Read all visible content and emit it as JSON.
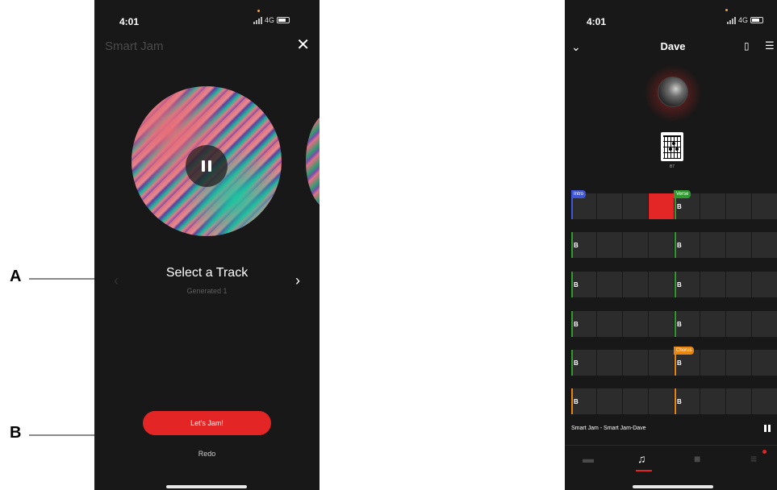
{
  "annotations": {
    "a_label": "A",
    "b_label": "B"
  },
  "left_phone": {
    "status": {
      "time": "4:01",
      "network": "4G"
    },
    "app_title": "Smart Jam",
    "close_icon": "close-icon",
    "track": {
      "title": "Select a Track",
      "subtitle": "Generated 1"
    },
    "primary_button": "Let's Jam!",
    "secondary_link": "Redo"
  },
  "right_phone": {
    "status": {
      "time": "4:01",
      "network": "4G"
    },
    "title": "Dave",
    "chord": {
      "name": "B7"
    },
    "sections": {
      "intro": "Intro",
      "verse": "Verse",
      "chorus": "Chorus"
    },
    "chord_label": "B",
    "now_playing": "Smart Jam - Smart Jam-Dave",
    "tabs": [
      "briefcase-icon",
      "music-note-icon",
      "video-camera-icon",
      "menu-icon"
    ],
    "colors": {
      "accent": "#e42525",
      "intro": "#3f56d6",
      "verse": "#2f9b2f",
      "chorus": "#e8850f"
    }
  }
}
